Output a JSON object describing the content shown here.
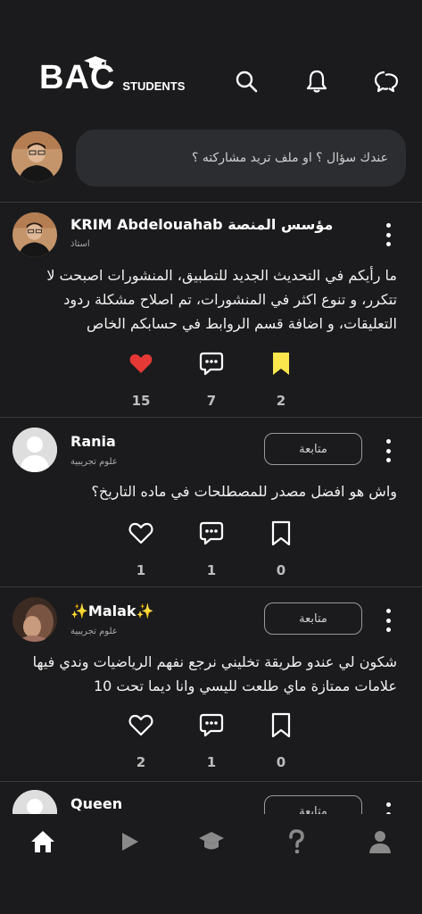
{
  "header": {
    "logo_text": "BAC",
    "logo_suffix": "STUDENTS",
    "icons": [
      "search-icon",
      "bell-icon",
      "chat-icon"
    ]
  },
  "composer": {
    "placeholder": "عندك سؤال ؟ او ملف تريد مشاركته ؟"
  },
  "posts": [
    {
      "author": "KRIM Abdelouahab مؤسس المنصة",
      "subtitle": "استاذ",
      "text": "ما رأيكم في التحديث الجديد للتطبيق، المنشورات اصبحت لا تتكرر، و تنوع اكثر في المنشورات، تم اصلاح مشكلة ردود التعليقات، و اضافة قسم الروابط في حسابكم الخاص",
      "likes": "15",
      "comments": "7",
      "saves": "2",
      "liked": true,
      "saved": true,
      "accent_like": "#e53935",
      "accent_save": "#fbe64d"
    },
    {
      "author": "Rania",
      "subtitle": "علوم تجريبية",
      "follow_label": "متابعة",
      "text": "واش هو افضل مصدر للمصطلحات في ماده التاريخ؟",
      "likes": "1",
      "comments": "1",
      "saves": "0"
    },
    {
      "author": "✨Malak✨",
      "subtitle": "علوم تجريبية",
      "follow_label": "متابعة",
      "text": "شكون لي عندو طريقة تخليني نرجع نفهم الرياضيات وندي فيها علامات ممتازة ماي طلعت لليسي وانا ديما تحت 10",
      "likes": "2",
      "comments": "1",
      "saves": "0"
    },
    {
      "author": "Queen",
      "follow_label": "متابعة"
    }
  ],
  "bottom_nav": {
    "items": [
      "home-icon",
      "play-icon",
      "graduation-cap-icon",
      "question-icon",
      "profile-icon"
    ],
    "active": "home-icon"
  }
}
